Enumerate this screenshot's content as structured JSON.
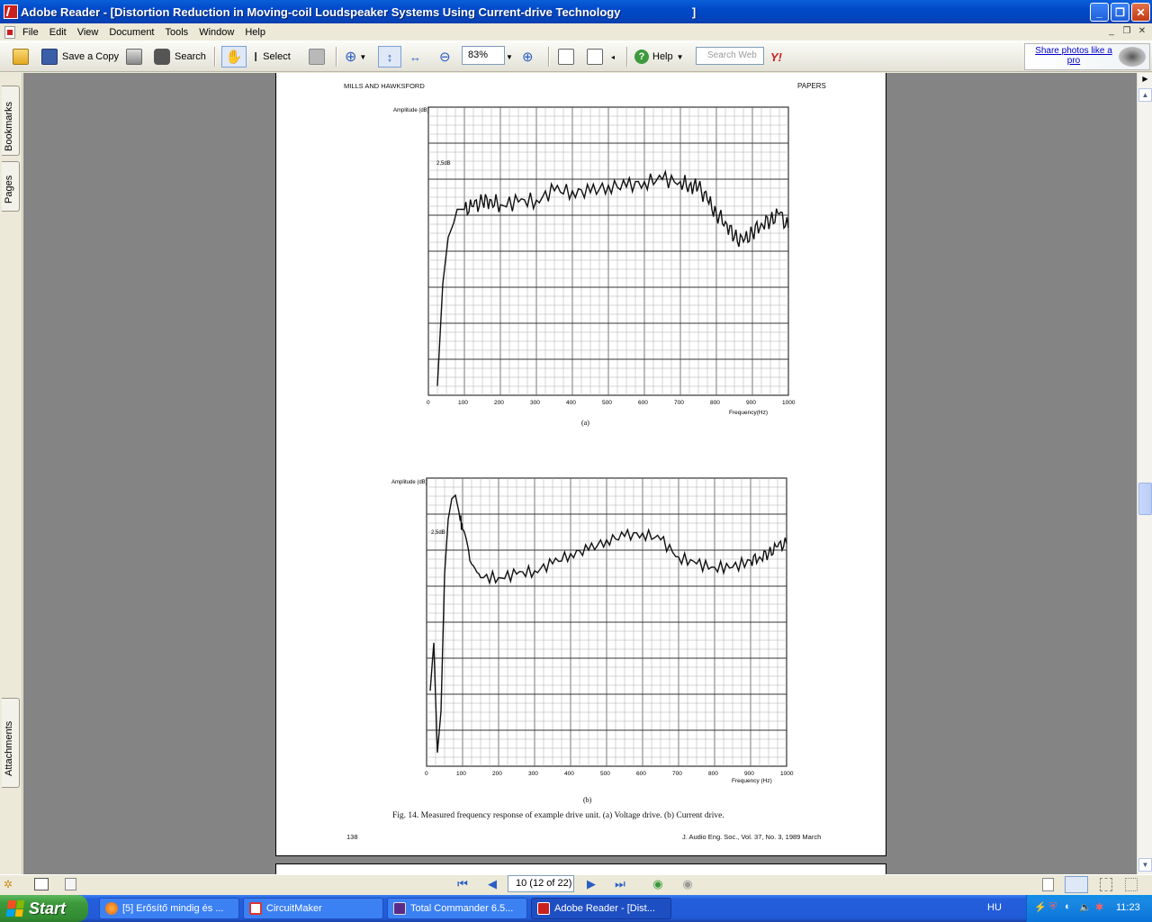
{
  "window": {
    "title": "Adobe Reader - [Distortion Reduction in Moving-coil Loudspeaker Systems Using Current-drive Technology                      ]"
  },
  "menu": [
    "File",
    "Edit",
    "View",
    "Document",
    "Tools",
    "Window",
    "Help"
  ],
  "toolbar": {
    "save_copy": "Save a Copy",
    "search": "Search",
    "select": "Select",
    "zoom_value": "83%",
    "help": "Help",
    "search_web_placeholder": "Search Web",
    "promo": "Share photos like a pro"
  },
  "nav_tabs": {
    "bookmarks": "Bookmarks",
    "pages": "Pages",
    "attachments": "Attachments"
  },
  "document": {
    "header_left": "MILLS AND HAWKSFORD",
    "header_right": "PAPERS",
    "plot_a": {
      "ylabel": "Amplitude (dB)",
      "scale": "2,5dB",
      "xlabel": "Frequency(Hz)",
      "label": "(a)",
      "ticks": [
        "0",
        "100",
        "200",
        "300",
        "400",
        "500",
        "600",
        "700",
        "800",
        "900",
        "1000"
      ]
    },
    "plot_b": {
      "ylabel": "Amplitude (dB)",
      "scale": "2,5dB",
      "xlabel": "Frequency (Hz)",
      "label": "(b)",
      "ticks": [
        "0",
        "100",
        "200",
        "300",
        "400",
        "500",
        "600",
        "700",
        "800",
        "900",
        "1000"
      ]
    },
    "caption": "Fig. 14. Measured frequency response of example drive unit. (a) Voltage drive. (b) Current drive.",
    "page_number": "138",
    "journal": "J. Audio Eng. Soc., Vol. 37, No. 3, 1989 March"
  },
  "chart_data": [
    {
      "type": "line",
      "title": "",
      "xlabel": "Frequency(Hz)",
      "ylabel": "Amplitude (dB)",
      "xlim": [
        0,
        1000
      ],
      "grid": true,
      "x": [
        25,
        40,
        55,
        70,
        80,
        100,
        125,
        150,
        175,
        200,
        250,
        300,
        350,
        400,
        450,
        500,
        550,
        600,
        650,
        700,
        725,
        750,
        775,
        800,
        825,
        850,
        875,
        900,
        925,
        950,
        975,
        1000
      ],
      "y": [
        -19,
        -8,
        -3,
        -1.5,
        0,
        0,
        0.3,
        0.8,
        1,
        0.5,
        0.8,
        1,
        2,
        2,
        1.8,
        2.6,
        2.4,
        3,
        3.2,
        3,
        2.6,
        2.4,
        1,
        -0.5,
        -1.3,
        -3,
        -3.5,
        -2.5,
        -1.5,
        -1.2,
        -0.5,
        -2
      ]
    },
    {
      "type": "line",
      "title": "",
      "xlabel": "Frequency (Hz)",
      "ylabel": "Amplitude (dB)",
      "xlim": [
        0,
        1000
      ],
      "grid": true,
      "x": [
        10,
        20,
        30,
        40,
        50,
        60,
        70,
        80,
        90,
        100,
        120,
        150,
        200,
        250,
        300,
        350,
        400,
        450,
        500,
        550,
        600,
        650,
        700,
        750,
        800,
        850,
        900,
        925,
        950,
        975,
        1000
      ],
      "y": [
        -25,
        -18,
        -34,
        -28,
        -8,
        0,
        3,
        3.5,
        1,
        -1.5,
        -6,
        -8.5,
        -8.5,
        -8,
        -7.5,
        -6.5,
        -5,
        -4.5,
        -3,
        -2.5,
        -2,
        -3,
        -5.5,
        -6.5,
        -7,
        -7,
        -6,
        -5.5,
        -5,
        -4,
        -3.5
      ]
    }
  ],
  "statusbar": {
    "page_field": "10  (12 of 22)"
  },
  "taskbar": {
    "start": "Start",
    "tasks": [
      "[5] Erősítő mindig és ...",
      "CircuitMaker",
      "Total Commander 6.5...",
      "Adobe Reader - [Dist..."
    ],
    "lang": "HU",
    "clock": "11:23"
  }
}
